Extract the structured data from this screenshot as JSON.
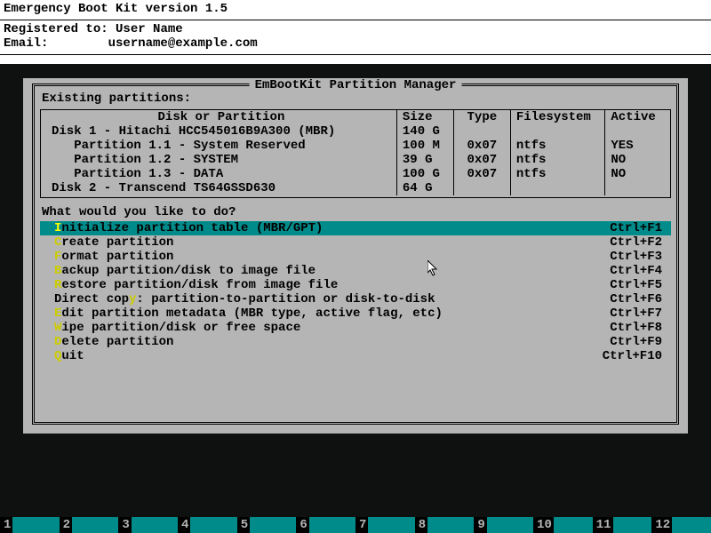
{
  "header": {
    "title": "Emergency Boot Kit version 1.5",
    "registered_label": "Registered to: ",
    "registered_value": "User Name",
    "email_label": "Email:        ",
    "email_value": "username@example.com"
  },
  "panel": {
    "title": " EmBootKit Partition Manager ",
    "subhead": "Existing partitions:",
    "columns": [
      "Disk or Partition",
      "Size",
      "Type",
      "Filesystem",
      "Active"
    ],
    "rows": [
      {
        "name": "Disk 1 - Hitachi HCC545016B9A300 (MBR)",
        "size": "140 G",
        "type": "",
        "fs": "",
        "active": ""
      },
      {
        "name": "   Partition 1.1 - System Reserved",
        "size": "100 M",
        "type": "0x07",
        "fs": "ntfs",
        "active": "YES"
      },
      {
        "name": "   Partition 1.2 - SYSTEM",
        "size": "39 G",
        "type": "0x07",
        "fs": "ntfs",
        "active": "NO"
      },
      {
        "name": "   Partition 1.3 - DATA",
        "size": "100 G",
        "type": "0x07",
        "fs": "ntfs",
        "active": "NO"
      },
      {
        "name": "Disk 2 - Transcend TS64GSSD630",
        "size": "64 G",
        "type": "",
        "fs": "",
        "active": ""
      }
    ],
    "prompt": "What would you like to do?",
    "menu": [
      {
        "hotkey": "I",
        "hotpos": 0,
        "label": "Initialize partition table (MBR/GPT)",
        "shortcut": "Ctrl+F1",
        "selected": true
      },
      {
        "hotkey": "C",
        "hotpos": 0,
        "label": "Create partition",
        "shortcut": "Ctrl+F2",
        "selected": false
      },
      {
        "hotkey": "F",
        "hotpos": 0,
        "label": "Format partition",
        "shortcut": "Ctrl+F3",
        "selected": false
      },
      {
        "hotkey": "B",
        "hotpos": 0,
        "label": "Backup partition/disk to image file",
        "shortcut": "Ctrl+F4",
        "selected": false
      },
      {
        "hotkey": "R",
        "hotpos": 0,
        "label": "Restore partition/disk from image file",
        "shortcut": "Ctrl+F5",
        "selected": false
      },
      {
        "hotkey": "y",
        "hotpos": 10,
        "label": "Direct copy: partition-to-partition or disk-to-disk",
        "shortcut": "Ctrl+F6",
        "selected": false
      },
      {
        "hotkey": "E",
        "hotpos": 0,
        "label": "Edit partition metadata (MBR type, active flag, etc)",
        "shortcut": "Ctrl+F7",
        "selected": false
      },
      {
        "hotkey": "W",
        "hotpos": 0,
        "label": "Wipe partition/disk or free space",
        "shortcut": "Ctrl+F8",
        "selected": false
      },
      {
        "hotkey": "D",
        "hotpos": 0,
        "label": "Delete partition",
        "shortcut": "Ctrl+F9",
        "selected": false
      },
      {
        "hotkey": "Q",
        "hotpos": 0,
        "label": "Quit",
        "shortcut": "Ctrl+F10",
        "selected": false
      }
    ]
  },
  "fnbar": {
    "slots": [
      "1",
      "2",
      "3",
      "4",
      "5",
      "6",
      "7",
      "8",
      "9",
      "10",
      "11",
      "12"
    ]
  },
  "colors": {
    "panel_bg": "#b5b5b5",
    "highlight": "#008b8b",
    "hotkey": "#cccc00"
  }
}
